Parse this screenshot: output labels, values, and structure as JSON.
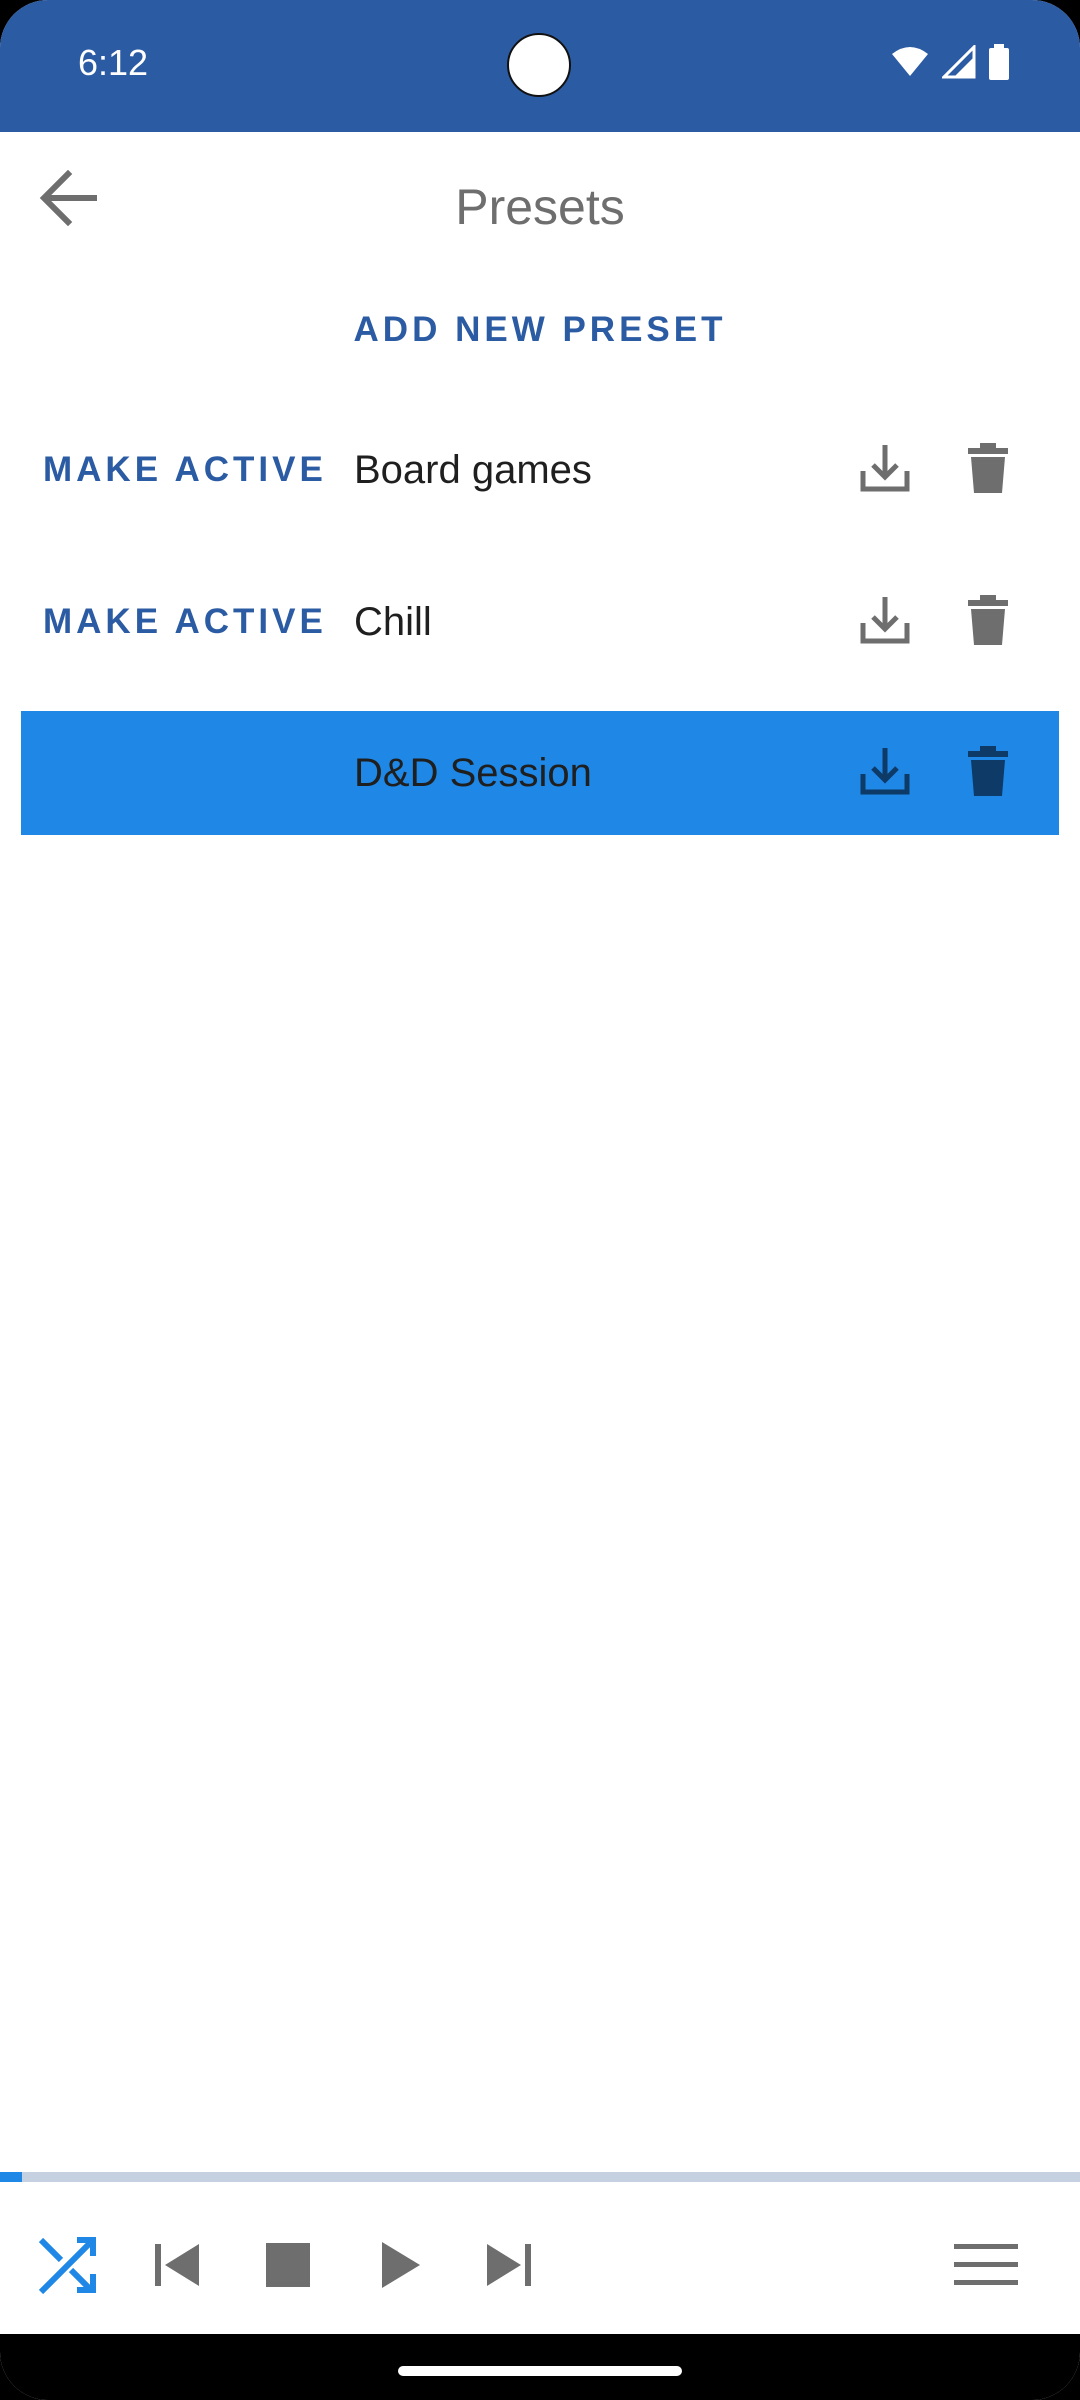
{
  "status_bar": {
    "time": "6:12",
    "icons": [
      "wifi-icon",
      "signal-icon",
      "battery-icon"
    ],
    "background": "#2b5ba3"
  },
  "header": {
    "back_icon": "arrow-left-icon",
    "title": "Presets"
  },
  "add_preset_label": "ADD NEW PRESET",
  "presets": [
    {
      "name": "Board games",
      "make_active_label": "MAKE ACTIVE",
      "active": false
    },
    {
      "name": "Chill",
      "make_active_label": "MAKE ACTIVE",
      "active": false
    },
    {
      "name": "D&D Session",
      "make_active_label": "",
      "active": true
    }
  ],
  "row_icons": {
    "download": "download-icon",
    "delete": "trash-icon"
  },
  "player": {
    "progress_fraction": 0.02,
    "controls": [
      "shuffle-icon",
      "skip-previous-icon",
      "stop-icon",
      "play-icon",
      "skip-next-icon",
      "menu-icon"
    ],
    "shuffle_active": true
  },
  "colors": {
    "accent": "#2b5ba3",
    "active_row": "#1f87e5",
    "icon_gray": "#6e6e6e",
    "active_icon": "#0d3a66"
  }
}
